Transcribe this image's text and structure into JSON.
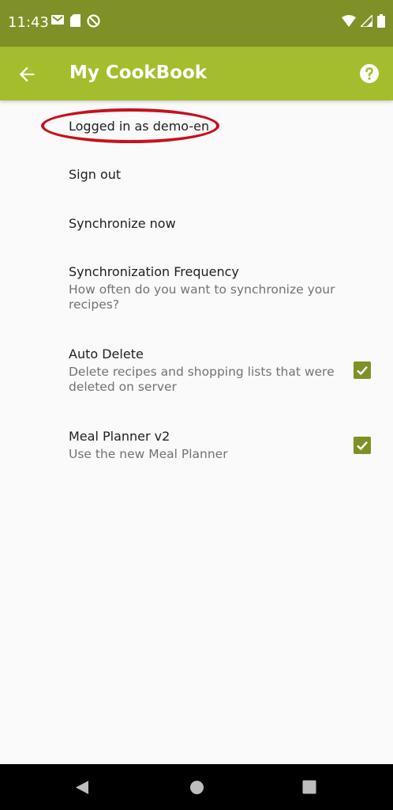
{
  "status_bar": {
    "time": "11:43",
    "left_icons": [
      "gmail-icon",
      "sd-card-icon",
      "no-disturb-icon"
    ],
    "right_icons": [
      "wifi-icon",
      "signal-icon",
      "battery-icon"
    ]
  },
  "app_bar": {
    "title": "My CookBook",
    "back_icon": "arrow-left-icon",
    "help_icon": "help-circle-icon"
  },
  "preferences": [
    {
      "title": "Logged in as demo-en",
      "summary": "",
      "checked": null
    },
    {
      "title": "Sign out",
      "summary": "",
      "checked": null
    },
    {
      "title": "Synchronize now",
      "summary": "",
      "checked": null
    },
    {
      "title": "Synchronization Frequency",
      "summary": "How often do you want to synchronize your recipes?",
      "checked": null
    },
    {
      "title": "Auto Delete",
      "summary": "Delete recipes and shopping lists that were deleted on server",
      "checked": true
    },
    {
      "title": "Meal Planner v2",
      "summary": "Use the new Meal Planner",
      "checked": true
    }
  ],
  "nav_bar": {
    "icons": [
      "back-triangle-icon",
      "home-circle-icon",
      "recents-square-icon"
    ]
  },
  "colors": {
    "status_bar": "#7f9126",
    "app_bar": "#a4bd2d",
    "checkbox": "#7f9126",
    "annotation": "#c8101c"
  }
}
